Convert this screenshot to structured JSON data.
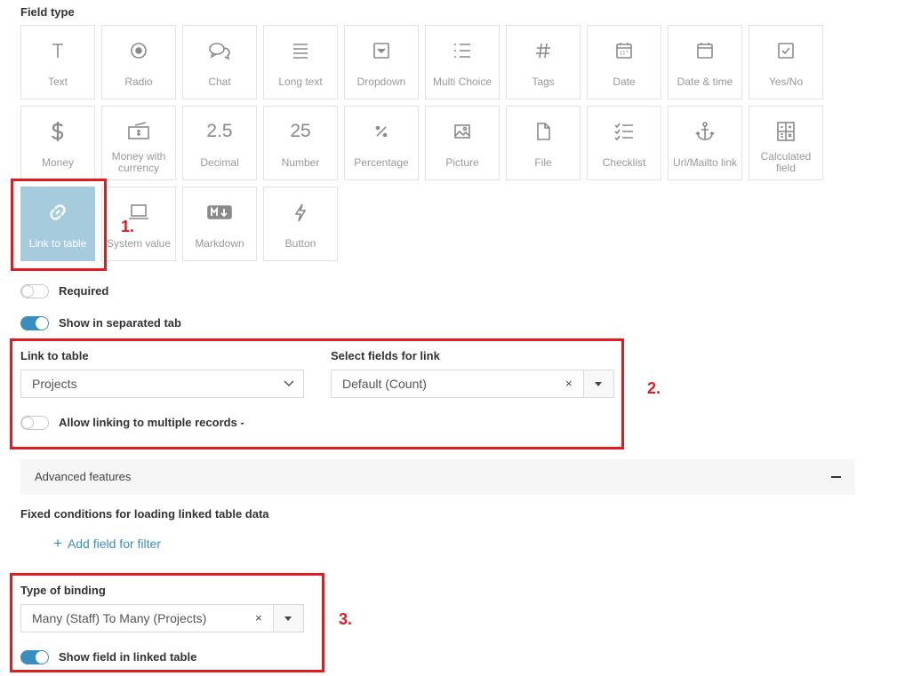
{
  "field_type_label": "Field type",
  "field_types": [
    {
      "label": "Text",
      "icon": "text-icon"
    },
    {
      "label": "Radio",
      "icon": "radio-icon"
    },
    {
      "label": "Chat",
      "icon": "chat-icon"
    },
    {
      "label": "Long text",
      "icon": "long-text-icon"
    },
    {
      "label": "Dropdown",
      "icon": "dropdown-icon"
    },
    {
      "label": "Multi Choice",
      "icon": "list-icon"
    },
    {
      "label": "Tags",
      "icon": "hash-icon"
    },
    {
      "label": "Date",
      "icon": "calendar-icon"
    },
    {
      "label": "Date & time",
      "icon": "calendar-time-icon"
    },
    {
      "label": "Yes/No",
      "icon": "checkbox-icon"
    },
    {
      "label": "Money",
      "icon": "dollar-icon"
    },
    {
      "label": "Money with currency",
      "icon": "banknote-icon"
    },
    {
      "label": "Decimal",
      "icon": "decimal-icon",
      "glyph": "2.5"
    },
    {
      "label": "Number",
      "icon": "number-icon",
      "glyph": "25"
    },
    {
      "label": "Percentage",
      "icon": "percent-icon"
    },
    {
      "label": "Picture",
      "icon": "image-icon"
    },
    {
      "label": "File",
      "icon": "file-icon"
    },
    {
      "label": "Checklist",
      "icon": "checklist-icon"
    },
    {
      "label": "Url/Mailto link",
      "icon": "anchor-icon"
    },
    {
      "label": "Calculated field",
      "icon": "calculator-icon"
    },
    {
      "label": "Link to table",
      "icon": "link-icon",
      "selected": true
    },
    {
      "label": "System value",
      "icon": "laptop-icon"
    },
    {
      "label": "Markdown",
      "icon": "markdown-icon"
    },
    {
      "label": "Button",
      "icon": "bolt-icon"
    }
  ],
  "annotations": {
    "one": "1.",
    "two": "2.",
    "three": "3."
  },
  "required": {
    "label": "Required",
    "on": false
  },
  "separated_tab": {
    "label": "Show in separated tab",
    "on": true
  },
  "link_to_table": {
    "label": "Link to table",
    "value": "Projects"
  },
  "select_fields": {
    "label": "Select fields for link",
    "value": "Default (Count)",
    "clear": "×"
  },
  "allow_multiple": {
    "label": "Allow linking to multiple records -",
    "on": false
  },
  "advanced": {
    "label": "Advanced features",
    "collapse_symbol": "−"
  },
  "fixed_conditions": {
    "label": "Fixed conditions for loading linked table data"
  },
  "add_filter": {
    "plus": "+",
    "label": "Add field for filter"
  },
  "binding": {
    "label": "Type of binding",
    "value": "Many (Staff) To Many (Projects)",
    "clear": "×"
  },
  "show_linked": {
    "label": "Show field in linked table",
    "on": true
  },
  "colors": {
    "accent": "#3a8dbf",
    "selected_tile": "#a6cbdd",
    "annotation_red": "#e11b22"
  }
}
